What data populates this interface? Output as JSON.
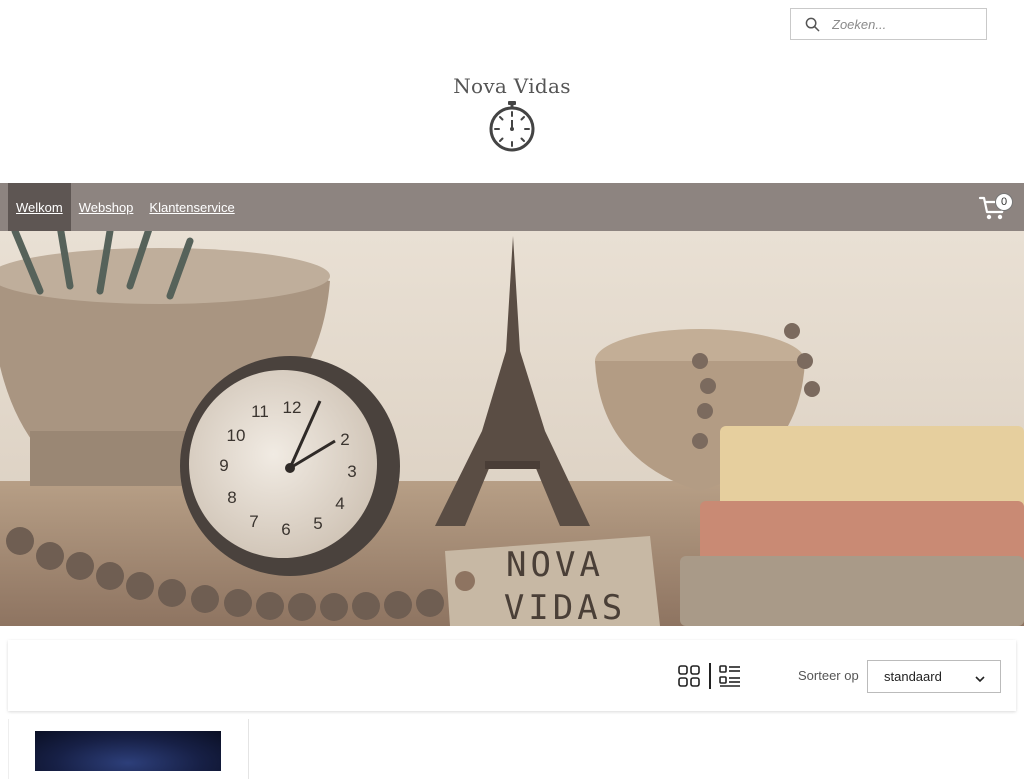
{
  "search": {
    "placeholder": "Zoeken...",
    "icon": "search-icon"
  },
  "brand": {
    "name": "Nova Vidas",
    "logo_icon": "stopwatch-icon"
  },
  "nav": {
    "items": [
      {
        "label": "Welkom",
        "active": true
      },
      {
        "label": "Webshop",
        "active": false
      },
      {
        "label": "Klantenservice",
        "active": false
      }
    ],
    "cart_icon": "cart-icon",
    "cart_count": "0"
  },
  "hero": {
    "alt_label": "Nova Vidas hero image",
    "tag_line1": "NOVA",
    "tag_line2": "VIDAS"
  },
  "toolbar": {
    "grid_icon": "grid-view-icon",
    "list_icon": "list-view-icon",
    "sort_label": "Sorteer op",
    "sort_value": "standaard"
  },
  "colors": {
    "nav_bg": "#8d8480",
    "nav_active_bg": "#5e5653",
    "text_dark": "#555555"
  }
}
